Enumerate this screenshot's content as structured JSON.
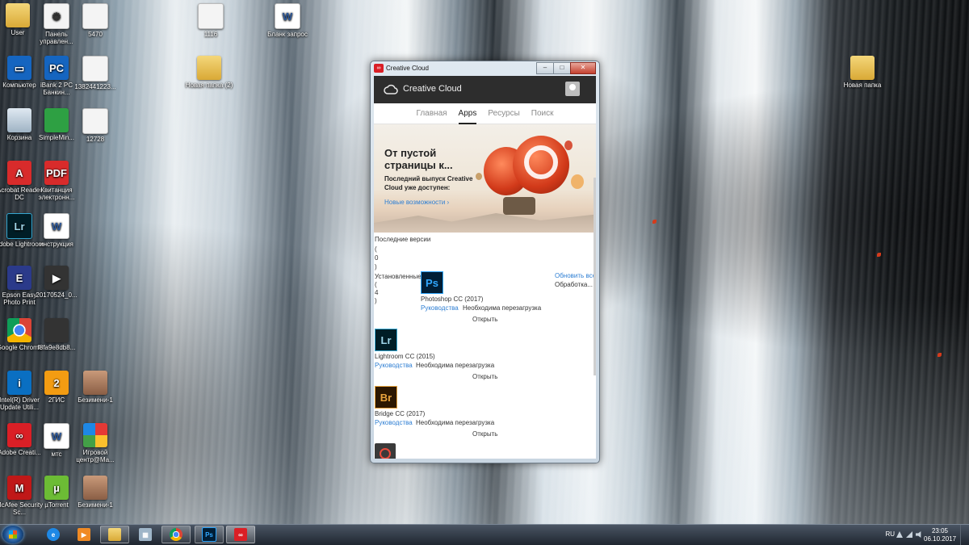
{
  "desktop": {
    "icons": [
      {
        "label": "User",
        "icon": "folder-icon"
      },
      {
        "label": "Панель управлен...",
        "icon": "control-panel-icon"
      },
      {
        "label": "5470",
        "icon": "document-icon"
      },
      {
        "label": "1116",
        "icon": "document-icon"
      },
      {
        "label": "Бланк запрос",
        "icon": "word-icon"
      },
      {
        "label": "Компьютер",
        "icon": "computer-icon"
      },
      {
        "label": "iBank 2 PC Банкин...",
        "icon": "ibank-icon"
      },
      {
        "label": "1382441223...",
        "icon": "image-icon"
      },
      {
        "label": "Новая папка (2)",
        "icon": "folder-icon"
      },
      {
        "label": "Корзина",
        "icon": "recycle-bin-icon"
      },
      {
        "label": "SimpleMin...",
        "icon": "minecraft-icon"
      },
      {
        "label": "12728",
        "icon": "document-icon"
      },
      {
        "label": "Acrobat Reader DC",
        "icon": "acrobat-icon"
      },
      {
        "label": "Квитанция электронн...",
        "icon": "pdf-icon"
      },
      {
        "label": "Adobe Lightroom",
        "icon": "lightroom-icon"
      },
      {
        "label": "инструкция",
        "icon": "word-icon"
      },
      {
        "label": "Epson Easy Photo Print",
        "icon": "epson-icon"
      },
      {
        "label": "20170524_0...",
        "icon": "video-icon"
      },
      {
        "label": "Google Chrome",
        "icon": "chrome-icon"
      },
      {
        "label": "f8fa9e8db8...",
        "icon": "image-icon"
      },
      {
        "label": "Intel(R) Driver Update Utili...",
        "icon": "intel-icon"
      },
      {
        "label": "2ГИС",
        "icon": "2gis-icon"
      },
      {
        "label": "Безимени-1",
        "icon": "image-icon"
      },
      {
        "label": "Adobe Creati...",
        "icon": "creative-cloud-icon"
      },
      {
        "label": "мтс",
        "icon": "word-icon"
      },
      {
        "label": "Игровой центр@Ma...",
        "icon": "rubik-icon"
      },
      {
        "label": "McAfee Security Sc...",
        "icon": "mcafee-icon"
      },
      {
        "label": "µTorrent",
        "icon": "utorrent-icon"
      },
      {
        "label": "Безимени-1",
        "icon": "image-icon"
      },
      {
        "label": "Новая папка",
        "icon": "folder-icon"
      }
    ]
  },
  "window": {
    "title": "Creative Cloud",
    "buttons": {
      "minimize": "–",
      "maximize": "□",
      "close": "✕"
    }
  },
  "cc": {
    "header_title": "Creative Cloud",
    "tabs": [
      {
        "label": "Главная"
      },
      {
        "label": "Apps"
      },
      {
        "label": "Ресурсы"
      },
      {
        "label": "Поиск"
      }
    ],
    "active_tab": "Apps",
    "banner": {
      "headline_1": "От пустой",
      "headline_2": "страницы к...",
      "sub": "Последний выпуск Creative Cloud уже доступен:",
      "link": "Новые возможности ›"
    },
    "recent_label": "Последние версии",
    "recent_paren": [
      "(",
      "0",
      ")"
    ],
    "installed_label": "Установленные",
    "installed_paren": [
      "(",
      "4",
      ")"
    ],
    "update_all": "Обновить все",
    "processing": "Обработка...",
    "apps": [
      {
        "abbr": "Ps",
        "name": "Photoshop CC (2017)",
        "guides": "Руководства",
        "status": "Необходима перезагрузка",
        "open": "Открыть",
        "color": "#31a8ff",
        "bg": "#001e36"
      },
      {
        "abbr": "Lr",
        "name": "Lightroom CC (2015)",
        "guides": "Руководства",
        "status": "Необходима перезагрузка",
        "open": "Открыть",
        "color": "#9ed4e8",
        "bg": "#001d26"
      },
      {
        "abbr": "Br",
        "name": "Bridge CC (2017)",
        "guides": "Руководства",
        "status": "Необходима перезагрузка",
        "open": "Открыть",
        "color": "#e8a33d",
        "bg": "#2c1700"
      }
    ]
  },
  "taskbar": {
    "items": [
      {
        "icon": "ie-icon"
      },
      {
        "icon": "media-player-icon"
      },
      {
        "icon": "explorer-icon"
      },
      {
        "icon": "calculator-icon"
      },
      {
        "icon": "chrome-icon"
      },
      {
        "icon": "photoshop-icon",
        "label": "Ps"
      },
      {
        "icon": "creative-cloud-icon"
      }
    ],
    "language": "RU",
    "time": "23:05",
    "date": "06.10.2017"
  }
}
